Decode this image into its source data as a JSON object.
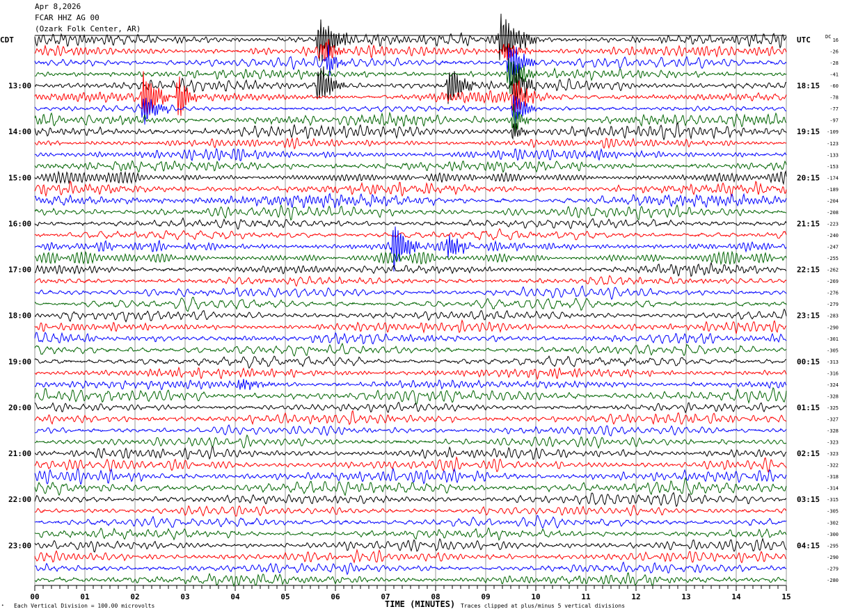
{
  "header": {
    "date": "Apr 8,2026",
    "station": "FCAR HHZ AG 00",
    "location": "(Ozark Folk Center, AR)"
  },
  "chart_data": {
    "type": "line",
    "subtype": "helicorder",
    "xlabel": "TIME (MINUTES)",
    "xlim": [
      0,
      15
    ],
    "x_ticks": [
      "00",
      "01",
      "02",
      "03",
      "04",
      "05",
      "06",
      "07",
      "08",
      "09",
      "10",
      "11",
      "12",
      "13",
      "14",
      "15"
    ],
    "left_timezone": "CDT",
    "right_timezone": "UTC",
    "left_hour_labels": [
      "13:00",
      "14:00",
      "15:00",
      "16:00",
      "17:00",
      "18:00",
      "19:00",
      "20:00",
      "21:00",
      "22:00",
      "23:00"
    ],
    "right_hour_labels": [
      "18:15",
      "19:15",
      "20:15",
      "21:15",
      "22:15",
      "23:15",
      "00:15",
      "01:15",
      "02:15",
      "03:15",
      "04:15"
    ],
    "dc_label": "DC",
    "dc_offsets": [
      16,
      -26,
      -28,
      -41,
      -60,
      -78,
      -77,
      -97,
      -109,
      -123,
      -133,
      -153,
      -174,
      -189,
      -204,
      -208,
      -223,
      -240,
      -247,
      -255,
      -262,
      -269,
      -276,
      -279,
      -283,
      -290,
      -301,
      -305,
      -313,
      -316,
      -324,
      -328,
      -325,
      -327,
      -328,
      -323,
      -323,
      -322,
      -318,
      -314,
      -315,
      -305,
      -302,
      -300,
      -295,
      -290,
      -279,
      -280
    ],
    "trace_count": 48,
    "trace_colors": [
      "#000000",
      "#ff0000",
      "#0000ff",
      "#006400"
    ],
    "events": [
      {
        "trace": 0,
        "start_min": 5.6,
        "end_min": 6.2,
        "amplitude_div": 5
      },
      {
        "trace": 0,
        "start_min": 9.2,
        "end_min": 9.9,
        "amplitude_div": 5
      },
      {
        "trace": 1,
        "start_min": 5.7,
        "end_min": 6.1,
        "amplitude_div": 3
      },
      {
        "trace": 1,
        "start_min": 9.3,
        "end_min": 9.8,
        "amplitude_div": 2
      },
      {
        "trace": 2,
        "start_min": 5.8,
        "end_min": 6.1,
        "amplitude_div": 3
      },
      {
        "trace": 2,
        "start_min": 9.4,
        "end_min": 9.9,
        "amplitude_div": 4
      },
      {
        "trace": 3,
        "start_min": 9.4,
        "end_min": 9.9,
        "amplitude_div": 4
      },
      {
        "trace": 4,
        "start_min": 5.6,
        "end_min": 6.1,
        "amplitude_div": 4
      },
      {
        "trace": 4,
        "start_min": 8.2,
        "end_min": 8.7,
        "amplitude_div": 4
      },
      {
        "trace": 4,
        "start_min": 9.5,
        "end_min": 9.9,
        "amplitude_div": 5
      },
      {
        "trace": 5,
        "start_min": 2.1,
        "end_min": 2.6,
        "amplitude_div": 5
      },
      {
        "trace": 5,
        "start_min": 2.8,
        "end_min": 3.2,
        "amplitude_div": 4
      },
      {
        "trace": 5,
        "start_min": 9.5,
        "end_min": 9.9,
        "amplitude_div": 5
      },
      {
        "trace": 6,
        "start_min": 2.1,
        "end_min": 2.6,
        "amplitude_div": 3
      },
      {
        "trace": 6,
        "start_min": 9.5,
        "end_min": 9.9,
        "amplitude_div": 4
      },
      {
        "trace": 7,
        "start_min": 9.5,
        "end_min": 9.8,
        "amplitude_div": 3
      },
      {
        "trace": 8,
        "start_min": 9.5,
        "end_min": 9.8,
        "amplitude_div": 2
      },
      {
        "trace": 18,
        "start_min": 7.1,
        "end_min": 7.6,
        "amplitude_div": 5
      },
      {
        "trace": 18,
        "start_min": 8.2,
        "end_min": 8.6,
        "amplitude_div": 2.5
      },
      {
        "trace": 30,
        "start_min": 4.0,
        "end_min": 4.7,
        "amplitude_div": 1
      }
    ],
    "scale_note": "Each Vertical Division =  100.00 microvolts",
    "clip_note": "Traces clipped at plus/minus 5 vertical divisions"
  }
}
